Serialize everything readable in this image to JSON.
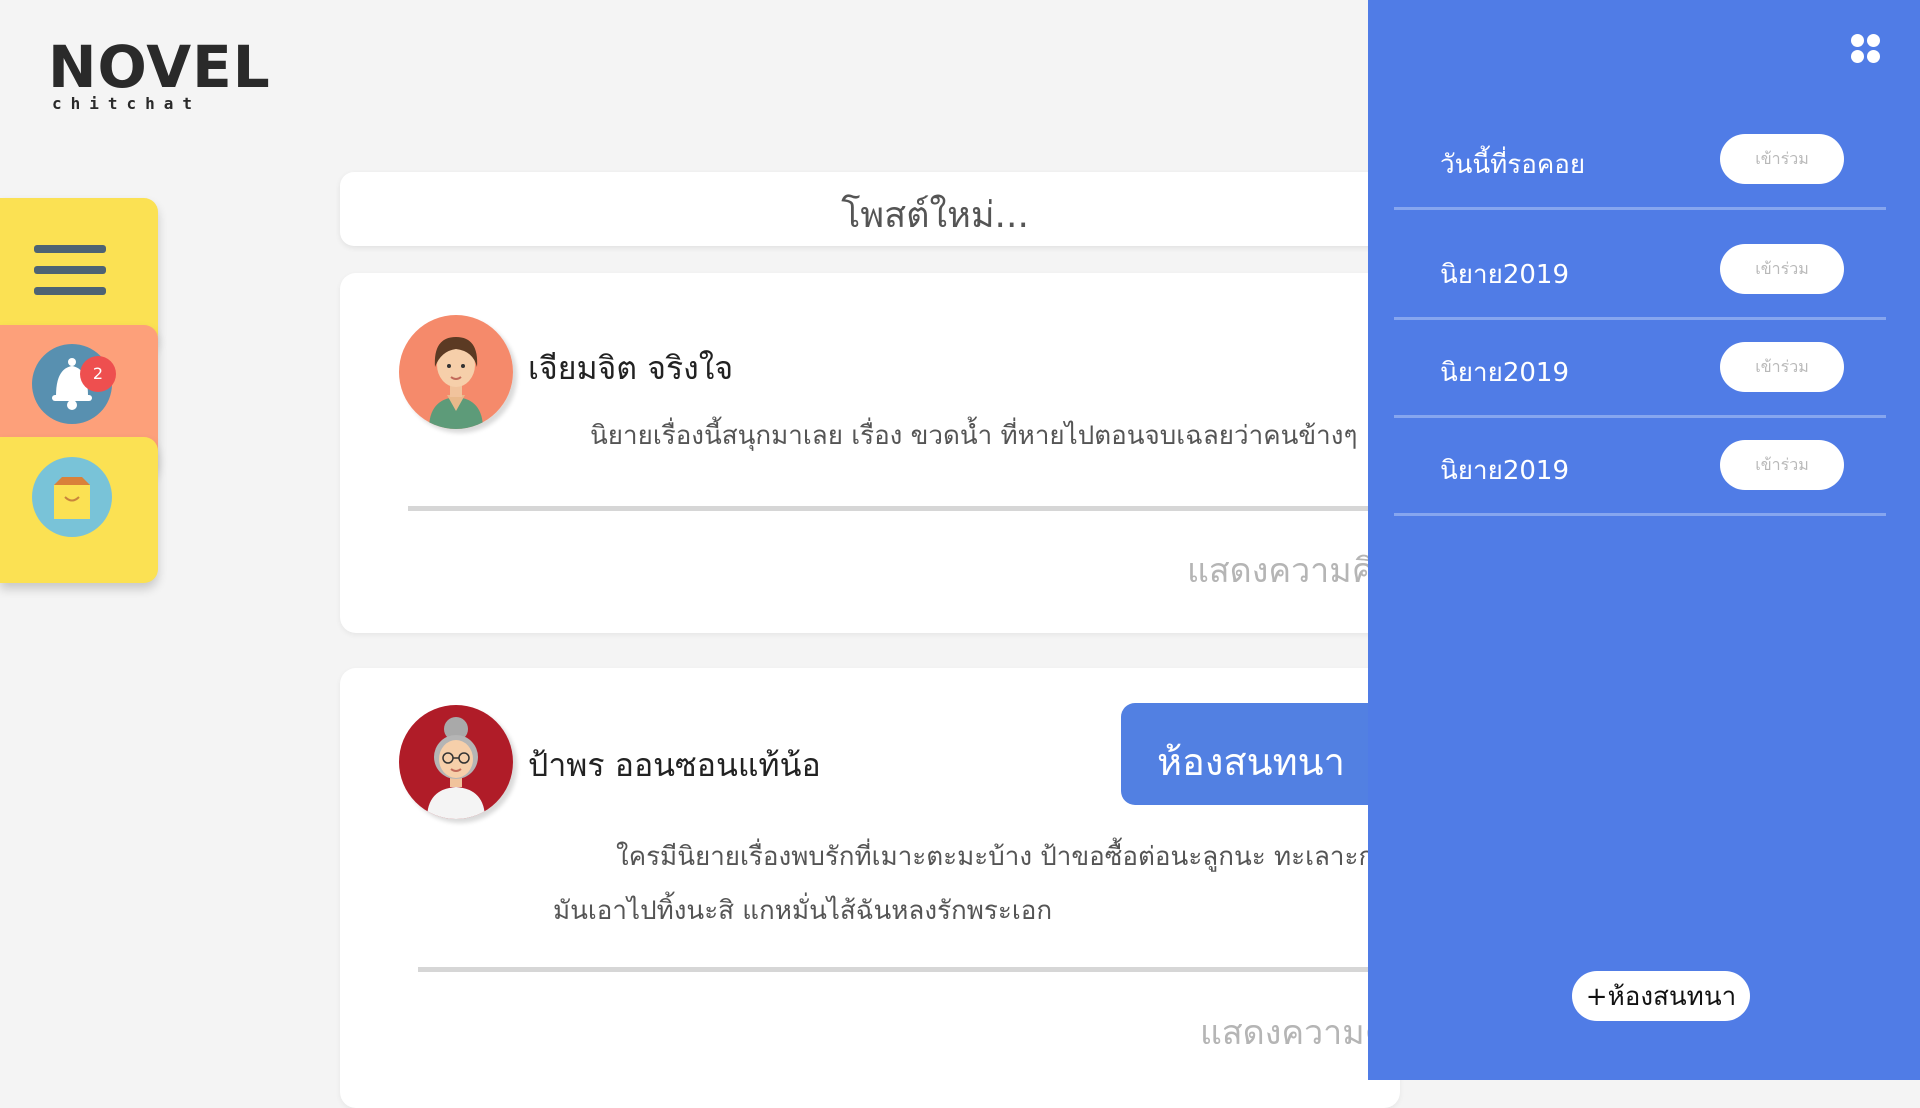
{
  "logo": {
    "main": "NOVEL",
    "sub": "chitchat"
  },
  "dock": {
    "notification_count": "2"
  },
  "feed": {
    "new_post_placeholder": "โพสต์ใหม่...",
    "posts": [
      {
        "author": "เจียมจิต จริงใจ",
        "lines": [
          "นิยายเรื่องนี้สนุกมาเลย เรื่อง ขวดน้ำ ที่หายไปตอนจบเฉลยว่าคนข้างๆ"
        ],
        "comment_placeholder": "แสดงความคิด"
      },
      {
        "author": "ป้าพร ออนซอนแท้น้อ",
        "lines": [
          "ใครมีนิยายเรื่องพบรักที่เมาะตะมะบ้าง ป้าขอซื้อต่อนะลูกนะ ทะเลาะก",
          "มันเอาไปทิ้งนะสิ แกหมั่นไส้ฉันหลงรักพระเอก"
        ],
        "comment_placeholder": "แสดงความคิ"
      }
    ]
  },
  "chat_tab": {
    "label": "ห้องสนทนา"
  },
  "chat_panel": {
    "rooms": [
      {
        "name": "วันนี้ที่รอคอย",
        "join_label": "เข้าร่วม"
      },
      {
        "name": "นิยาย2019",
        "join_label": "เข้าร่วม"
      },
      {
        "name": "นิยาย2019",
        "join_label": "เข้าร่วม"
      },
      {
        "name": "นิยาย2019",
        "join_label": "เข้าร่วม"
      }
    ],
    "add_room_label": "+ห้องสนทนา"
  },
  "colors": {
    "panel": "#507ce6",
    "dock_yellow": "#fbe153",
    "dock_orange": "#fda07a",
    "badge": "#ee4f4f"
  },
  "icons": {
    "menu": "hamburger-icon",
    "notifications": "bell-icon",
    "shop": "shopping-bag-icon",
    "apps": "grid-dots-icon"
  }
}
